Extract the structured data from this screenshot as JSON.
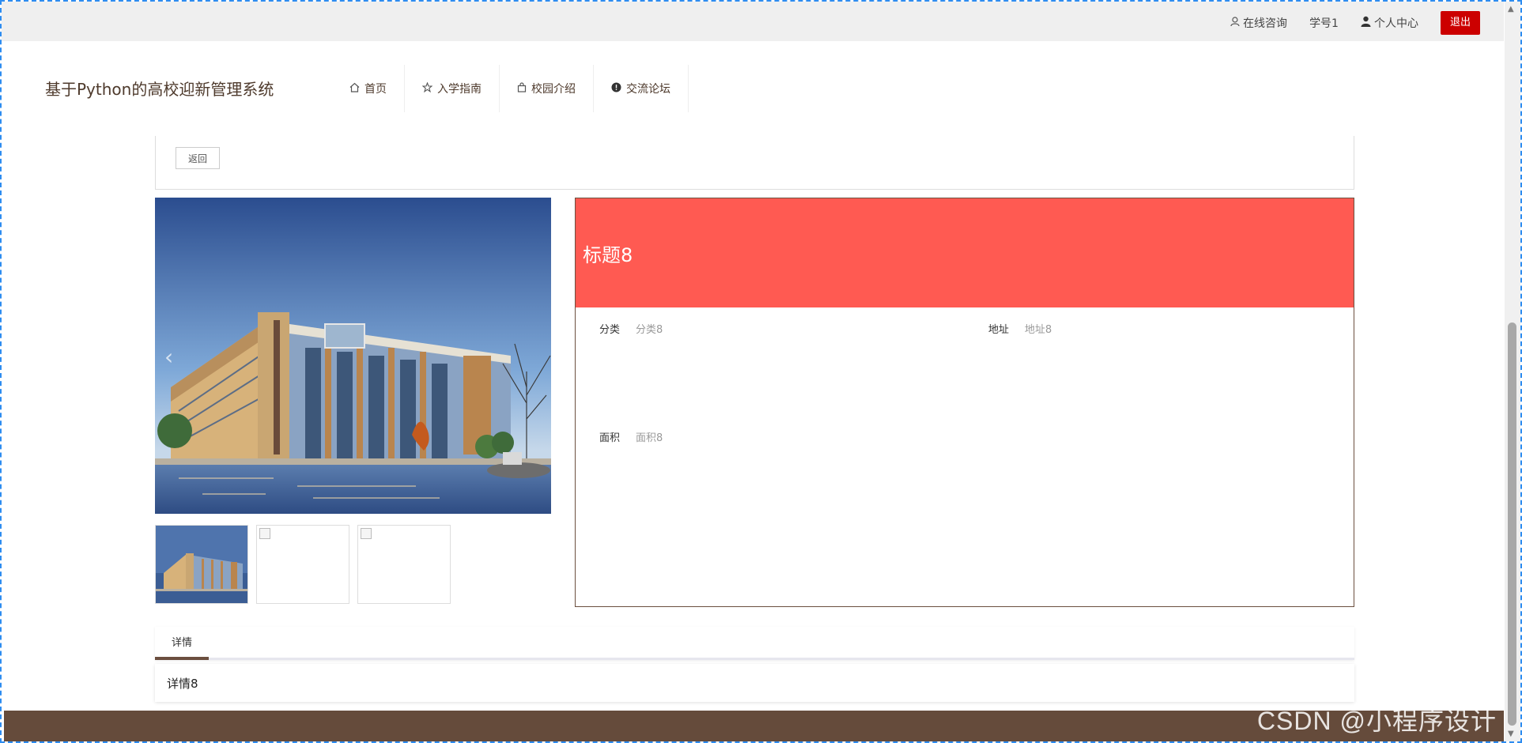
{
  "topbar": {
    "consult_label": "在线咨询",
    "student_id": "学号1",
    "profile_label": "个人中心",
    "logout_label": "退出"
  },
  "header": {
    "site_title": "基于Python的高校迎新管理系统",
    "nav": [
      {
        "label": "首页",
        "icon": "home-icon"
      },
      {
        "label": "入学指南",
        "icon": "star-icon"
      },
      {
        "label": "校园介绍",
        "icon": "bag-icon"
      },
      {
        "label": "交流论坛",
        "icon": "info-icon"
      }
    ]
  },
  "back": {
    "label": "返回"
  },
  "detail": {
    "title": "标题8",
    "fields": {
      "category_label": "分类",
      "category_value": "分类8",
      "address_label": "地址",
      "address_value": "地址8",
      "area_label": "面积",
      "area_value": "面积8"
    },
    "header_color": "#ff5a52"
  },
  "tabs": {
    "active_label": "详情",
    "content": "详情8"
  },
  "watermark": "CSDN @小程序设计",
  "colors": {
    "brand_brown": "#654b3b",
    "logout_red": "#cc0000",
    "header_red": "#ff5a52"
  }
}
